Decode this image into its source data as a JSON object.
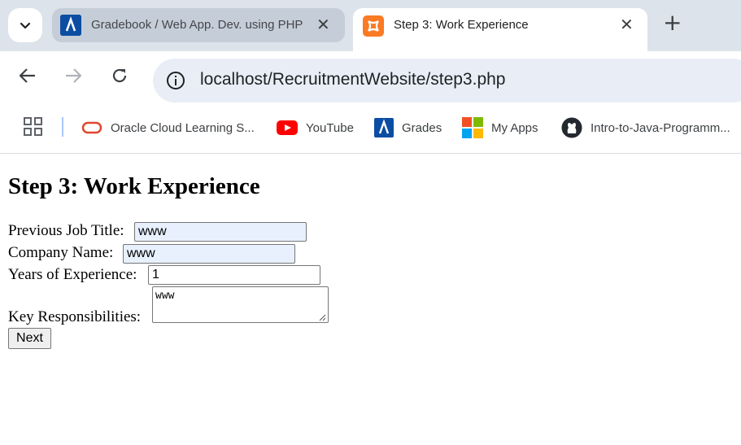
{
  "browser": {
    "tabs": [
      {
        "title": "Gradebook / Web App. Dev. using PHP",
        "active": false,
        "icon": "athabasca-icon"
      },
      {
        "title": "Step 3: Work Experience",
        "active": true,
        "icon": "xampp-icon"
      }
    ],
    "url": "localhost/RecruitmentWebsite/step3.php",
    "bookmarks": [
      {
        "label": "Oracle Cloud Learning S...",
        "icon": "oracle-icon"
      },
      {
        "label": "YouTube",
        "icon": "youtube-icon"
      },
      {
        "label": "Grades",
        "icon": "athabasca-icon"
      },
      {
        "label": "My Apps",
        "icon": "microsoft-icon"
      },
      {
        "label": "Intro-to-Java-Programm...",
        "icon": "github-icon"
      }
    ]
  },
  "page": {
    "heading": "Step 3: Work Experience",
    "fields": {
      "job_title": {
        "label": "Previous Job Title:",
        "value": "www"
      },
      "company": {
        "label": "Company Name:",
        "value": "www"
      },
      "years": {
        "label": "Years of Experience:",
        "value": "1"
      },
      "responsibilities": {
        "label": "Key Responsibilities:",
        "value": "www"
      }
    },
    "next_label": "Next"
  }
}
